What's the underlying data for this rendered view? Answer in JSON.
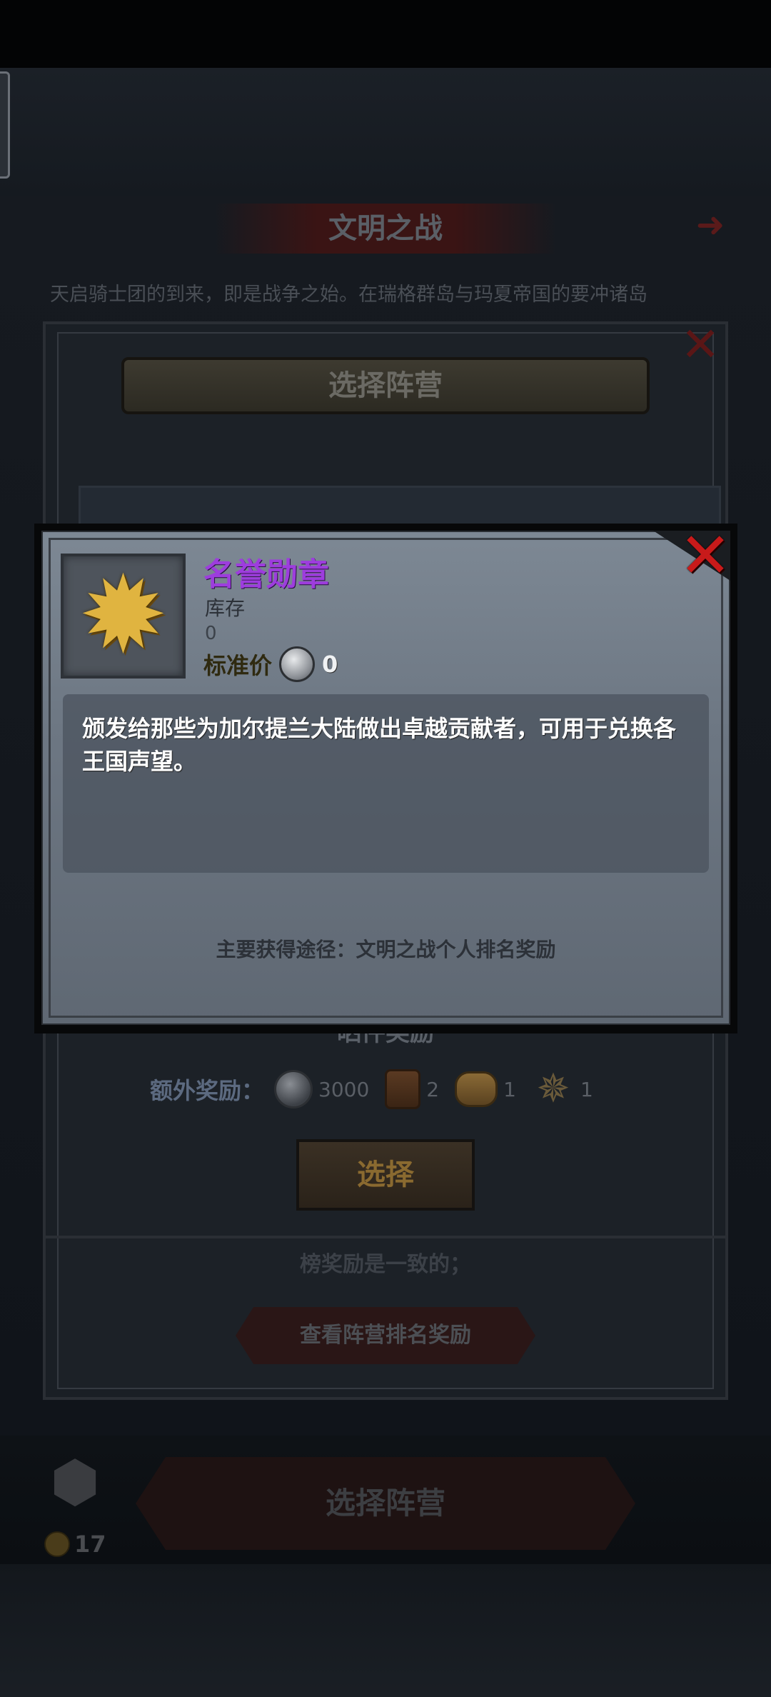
{
  "background": {
    "title": "文明之战",
    "intro": "天启骑士团的到来，即是战争之始。在瑞格群岛与玛夏帝国的要冲诸岛",
    "faction_header": "选择阵营",
    "partial_label": "晒件奖励",
    "extra_rewards": {
      "label": "额外奖励：",
      "items": [
        {
          "icon": "silver-coin-icon",
          "count": "3000"
        },
        {
          "icon": "beer-barrel-icon",
          "count": "2"
        },
        {
          "icon": "bread-icon",
          "count": "1"
        },
        {
          "icon": "honor-medal-icon",
          "count": "1"
        }
      ]
    },
    "select_button": "选择",
    "cut_text": "榜奖励是一致的；",
    "rank_reward_button": "查看阵营排名奖励",
    "bottom_button": "选择阵营",
    "bottom_count": "17"
  },
  "dialog": {
    "item_name": "名誉勋章",
    "stock_label": "库存",
    "stock_value": "0",
    "price_label": "标准价",
    "price_value": "0",
    "description": "颁发给那些为加尔提兰大陆做出卓越贡献者，可用于兑换各王国声望。",
    "source": "主要获得途径：文明之战个人排名奖励",
    "colors": {
      "item_name": "#9d3ddd",
      "close": "#c81a1a"
    }
  }
}
